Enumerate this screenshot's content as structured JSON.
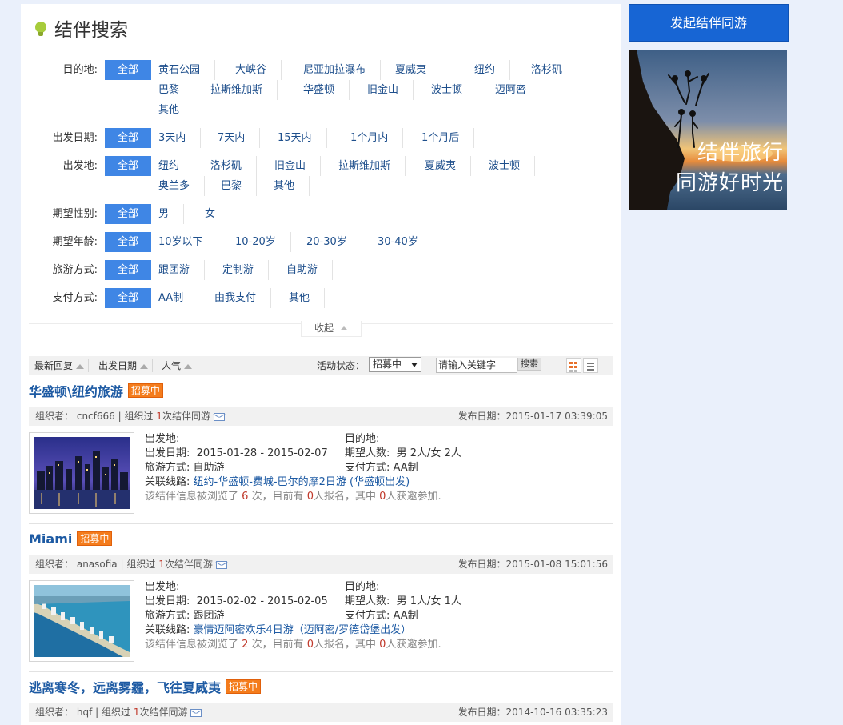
{
  "page": {
    "title": "结伴搜索"
  },
  "filters": [
    {
      "label": "目的地:",
      "all": "全部",
      "options": [
        "黄石公园",
        "大峡谷",
        "尼亚加拉瀑布",
        "夏威夷",
        "纽约",
        "洛杉矶",
        "巴黎",
        "拉斯维加斯",
        "华盛顿",
        "旧金山",
        "波士顿",
        "迈阿密",
        "其他"
      ]
    },
    {
      "label": "出发日期:",
      "all": "全部",
      "options": [
        "3天内",
        "7天内",
        "15天内",
        "1个月内",
        "1个月后"
      ]
    },
    {
      "label": "出发地:",
      "all": "全部",
      "options": [
        "纽约",
        "洛杉矶",
        "旧金山",
        "拉斯维加斯",
        "夏威夷",
        "波士顿",
        "奥兰多",
        "巴黎",
        "其他"
      ]
    },
    {
      "label": "期望性别:",
      "all": "全部",
      "options": [
        "男",
        "女"
      ]
    },
    {
      "label": "期望年龄:",
      "all": "全部",
      "options": [
        "10岁以下",
        "10-20岁",
        "20-30岁",
        "30-40岁"
      ]
    },
    {
      "label": "旅游方式:",
      "all": "全部",
      "options": [
        "跟团游",
        "定制游",
        "自助游"
      ]
    },
    {
      "label": "支付方式:",
      "all": "全部",
      "options": [
        "AA制",
        "由我支付",
        "其他"
      ]
    }
  ],
  "collapse_label": "收起",
  "sortbar": {
    "sort_latest_reply": "最新回复",
    "sort_departure": "出发日期",
    "sort_popularity": "人气",
    "status_label": "活动状态：",
    "status_value": "招募中",
    "keyword_placeholder": "请输入关键字",
    "search_label": "搜索"
  },
  "labels": {
    "organizer": "组织者：",
    "organized_prefix": "组织过",
    "organized_suffix": "次结伴同游",
    "publish_date": "发布日期：",
    "from": "出发地:",
    "to": "目的地:",
    "dates": "出发日期:",
    "people": "期望人数:",
    "travel_mode": "旅游方式:",
    "payment": "支付方式:",
    "route": "关联线路:",
    "stats_pre": "该结伴信息被浏览了",
    "stats_mid1": "次，目前有",
    "stats_mid2": "人报名，其中",
    "stats_end": "人获邀参加."
  },
  "posts": [
    {
      "title": "华盛顿\\纽约旅游",
      "badge": "招募中",
      "organizer": "cncf666",
      "organized_count": "1",
      "publish_date": "2015-01-17 03:39:05",
      "from": "",
      "to": "",
      "dates": "2015-01-28 - 2015-02-07",
      "people": "男 2人/女 2人",
      "travel_mode": "自助游",
      "payment": "AA制",
      "route": "纽约-华盛顿-费城-巴尔的摩2日游 (华盛顿出发)",
      "views": "6",
      "signups": "0",
      "invited": "0"
    },
    {
      "title": "Miami",
      "badge": "招募中",
      "organizer": "anasofia",
      "organized_count": "1",
      "publish_date": "2015-01-08 15:01:56",
      "from": "",
      "to": "",
      "dates": "2015-02-02 - 2015-02-05",
      "people": "男 1人/女 1人",
      "travel_mode": "跟团游",
      "payment": "AA制",
      "route": "豪情迈阿密欢乐4日游（迈阿密/罗德岱堡出发）",
      "views": "2",
      "signups": "0",
      "invited": "0"
    },
    {
      "title": "逃离寒冬，远离雾霾，飞往夏威夷",
      "badge": "招募中",
      "organizer": "hqf",
      "organized_count": "1",
      "publish_date": "2014-10-16 03:35:23"
    }
  ],
  "sidebar": {
    "launch_button": "发起结伴同游",
    "banner_line1": "结伴旅行",
    "banner_line2": "同游好时光"
  },
  "colors": {
    "accent": "#3f86e5",
    "link": "#1d5aa3",
    "badge": "#f47c1c",
    "button": "#1765d4",
    "page_bg": "#eaf0fb"
  }
}
